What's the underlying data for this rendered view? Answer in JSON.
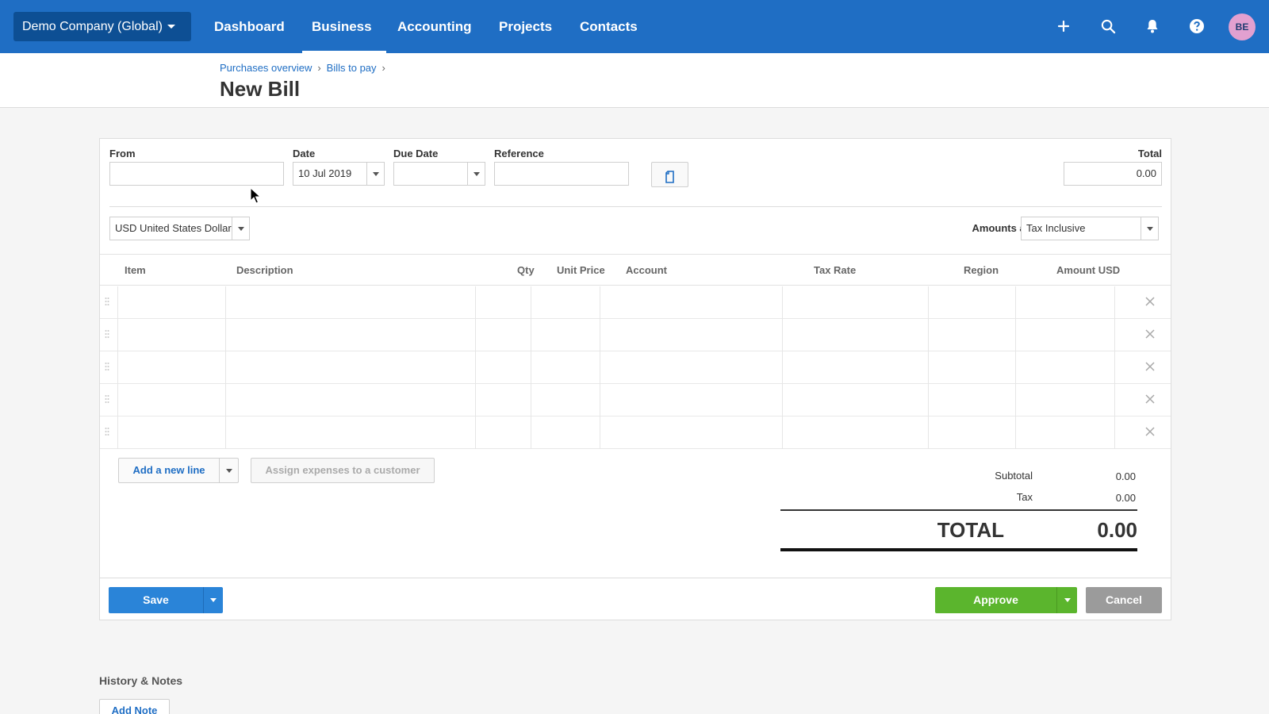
{
  "topnav": {
    "org_label": "Demo Company (Global)",
    "items": [
      {
        "label": "Dashboard"
      },
      {
        "label": "Business"
      },
      {
        "label": "Accounting"
      },
      {
        "label": "Projects"
      },
      {
        "label": "Contacts"
      }
    ],
    "active_item": "Business",
    "icons": [
      "plus-icon",
      "search-icon",
      "bell-icon",
      "help-icon"
    ],
    "avatar_initials": "BE",
    "brand_color": "#1f6ec4"
  },
  "breadcrumb": {
    "items": [
      "Purchases overview",
      "Bills to pay"
    ],
    "separator": "›"
  },
  "page_title": "New Bill",
  "form": {
    "from_label": "From",
    "from_value": "",
    "date_label": "Date",
    "date_value": "10 Jul 2019",
    "due_date_label": "Due Date",
    "due_date_value": "",
    "reference_label": "Reference",
    "reference_value": "",
    "total_label": "Total",
    "total_value": "0.00",
    "currency_value": "USD United States Dollar",
    "amounts_are_label": "Amounts are",
    "amounts_are_value": "Tax Inclusive"
  },
  "table": {
    "columns": [
      "Item",
      "Description",
      "Qty",
      "Unit Price",
      "Account",
      "Tax Rate",
      "Region",
      "Amount USD"
    ],
    "rows": [
      {
        "item": "",
        "description": "",
        "qty": "",
        "unit_price": "",
        "account": "",
        "tax_rate": "",
        "region": "",
        "amount": ""
      },
      {
        "item": "",
        "description": "",
        "qty": "",
        "unit_price": "",
        "account": "",
        "tax_rate": "",
        "region": "",
        "amount": ""
      },
      {
        "item": "",
        "description": "",
        "qty": "",
        "unit_price": "",
        "account": "",
        "tax_rate": "",
        "region": "",
        "amount": ""
      },
      {
        "item": "",
        "description": "",
        "qty": "",
        "unit_price": "",
        "account": "",
        "tax_rate": "",
        "region": "",
        "amount": ""
      },
      {
        "item": "",
        "description": "",
        "qty": "",
        "unit_price": "",
        "account": "",
        "tax_rate": "",
        "region": "",
        "amount": ""
      }
    ]
  },
  "actions": {
    "add_line_label": "Add a new line",
    "assign_label": "Assign expenses to a customer",
    "save_label": "Save",
    "approve_label": "Approve",
    "cancel_label": "Cancel",
    "approve_color": "#5bb52d",
    "save_color": "#2a84d8"
  },
  "totals": {
    "subtotal_label": "Subtotal",
    "subtotal_value": "0.00",
    "tax_label": "Tax",
    "tax_value": "0.00",
    "total_label": "TOTAL",
    "total_value": "0.00"
  },
  "history": {
    "heading": "History & Notes",
    "add_note_label": "Add Note"
  }
}
